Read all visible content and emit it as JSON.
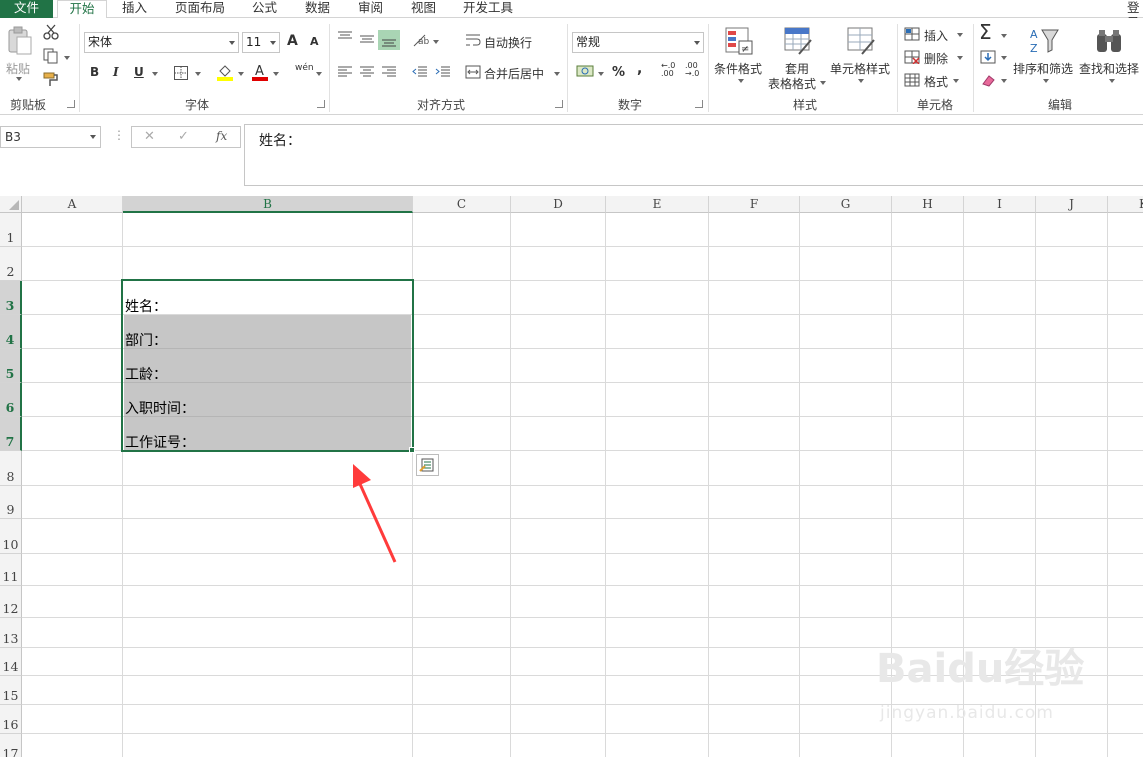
{
  "tabs": [
    "文件",
    "开始",
    "插入",
    "页面布局",
    "公式",
    "数据",
    "审阅",
    "视图",
    "开发工具"
  ],
  "login_label": "登录",
  "ribbon": {
    "clipboard": {
      "paste": "粘贴",
      "label": "剪贴板"
    },
    "font": {
      "name": "宋体",
      "size": "11",
      "grow": "A",
      "shrink": "A",
      "bold": "B",
      "italic": "I",
      "underline": "U",
      "phonetic": "wén",
      "label": "字体"
    },
    "align": {
      "wrap": "自动换行",
      "merge": "合并后居中",
      "label": "对齐方式"
    },
    "number": {
      "format": "常规",
      "percent": "%",
      "comma": ",",
      "inc_dec": "←.0 .00",
      "dec_dec": ".00 →.0",
      "label": "数字"
    },
    "styles": {
      "conditional": "条件格式",
      "table_line1": "套用",
      "table_line2": "表格格式",
      "cell_styles": "单元格样式",
      "label": "样式"
    },
    "cells": {
      "insert": "插入",
      "delete": "删除",
      "format": "格式",
      "label": "单元格"
    },
    "editing": {
      "sort": "排序和筛选",
      "find": "查找和选择",
      "label": "编辑"
    }
  },
  "formula_bar": {
    "name_box": "B3",
    "cancel": "✕",
    "enter": "✓",
    "fx": "fx",
    "content": "姓名："
  },
  "columns": [
    "A",
    "B",
    "C",
    "D",
    "E",
    "F",
    "G",
    "H",
    "I",
    "J",
    "K"
  ],
  "selected_column": "B",
  "rows": [
    "1",
    "2",
    "3",
    "4",
    "5",
    "6",
    "7",
    "8",
    "9",
    "10",
    "11",
    "12",
    "13",
    "14",
    "15",
    "16",
    "17"
  ],
  "selected_rows": [
    "3",
    "4",
    "5",
    "6",
    "7"
  ],
  "cells": {
    "B3": "姓名：",
    "B4": "部门：",
    "B5": "工龄：",
    "B6": "入职时间：",
    "B7": "工作证号："
  },
  "colors": {
    "accent": "#217346",
    "selection_fill": "#c6c6c6",
    "arrow": "#ff3b3b"
  },
  "watermark": {
    "brand": "Baidu经验",
    "url": "jingyan.baidu.com"
  }
}
